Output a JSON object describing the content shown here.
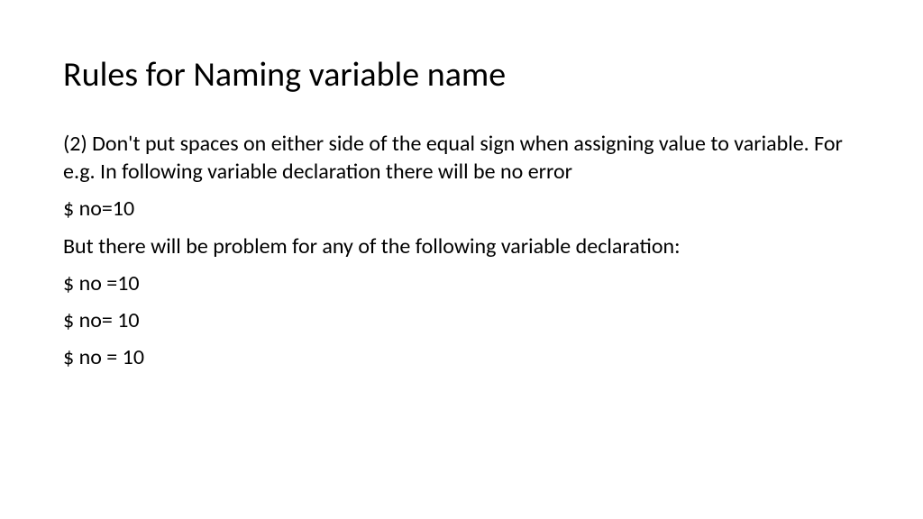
{
  "title": "Rules for Naming variable name",
  "paragraphs": [
    "(2) Don't put spaces on either side of the equal sign when assigning value to variable. For e.g. In following variable declaration there will be no error",
    "$ no=10",
    "But there will be problem for any of the following variable declaration:",
    "$ no =10",
    "$ no= 10",
    "$ no = 10"
  ]
}
